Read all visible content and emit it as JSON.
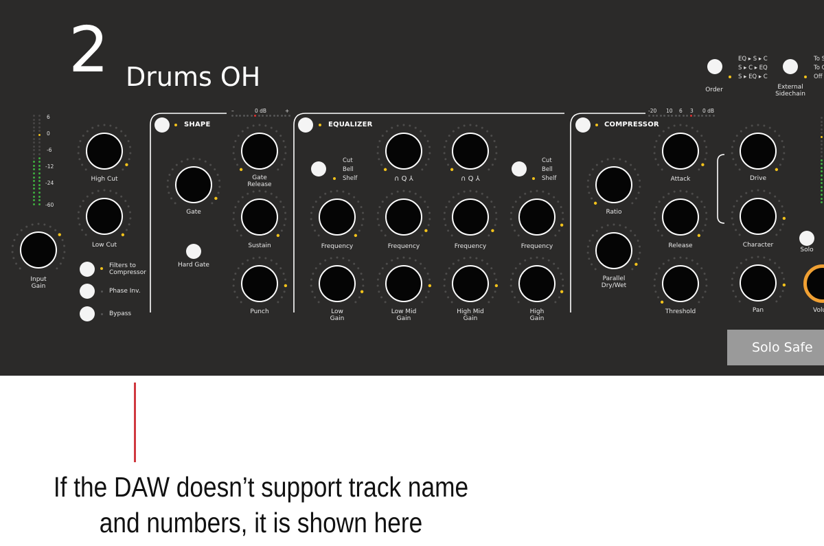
{
  "track": {
    "number": "2",
    "name": "Drums OH"
  },
  "order": {
    "label": "Order",
    "options": [
      "EQ ▸ S ▸ C",
      "S ▸ C ▸ EQ",
      "S ▸ EQ ▸ C"
    ]
  },
  "sidechain": {
    "label": "External\nSidechain",
    "options": [
      "To S",
      "To C",
      "Off"
    ]
  },
  "input": {
    "meter_scale": [
      "6",
      "0",
      "-6",
      "-12",
      "-24",
      "-60"
    ],
    "gain_label": "Input\nGain"
  },
  "filters": {
    "high_cut": "High Cut",
    "low_cut": "Low Cut"
  },
  "toggles": {
    "filters_to_compressor": "Filters to\nCompressor",
    "phase_inv": "Phase Inv.",
    "bypass": "Bypass"
  },
  "shape": {
    "title": "SHAPE",
    "gate": "Gate",
    "hard_gate": "Hard Gate",
    "gate_release": "Gate\nRelease",
    "sustain": "Sustain",
    "punch": "Punch",
    "scale": [
      "–",
      "0 dB",
      "+"
    ]
  },
  "equalizer": {
    "title": "EQUALIZER",
    "low_shape": [
      "Cut",
      "Bell",
      "Shelf"
    ],
    "high_shape": [
      "Cut",
      "Bell",
      "Shelf"
    ],
    "q_label": "∩  Q  ⅄",
    "freq_label": "Frequency",
    "gains": [
      "Low\nGain",
      "Low Mid\nGain",
      "High Mid\nGain",
      "High\nGain"
    ]
  },
  "compressor": {
    "title": "COMPRESSOR",
    "ratio": "Ratio",
    "parallel": "Parallel\nDry/Wet",
    "attack": "Attack",
    "release": "Release",
    "threshold": "Threshold",
    "scale": [
      "-20",
      "10",
      "6",
      "3",
      "0 dB"
    ]
  },
  "output": {
    "drive": "Drive",
    "character": "Character",
    "pan": "Pan",
    "solo": "Solo",
    "volume": "Volu",
    "solo_safe": "Solo Safe"
  },
  "annotation": "If the DAW doesn’t support track name\nand numbers, it is shown here",
  "colors": {
    "panel": "#2b2a29",
    "accent_yellow": "#f2c21b",
    "meter_green": "#3fae3f",
    "meter_red": "#e03030",
    "volume_orange": "#f0a033",
    "callout_red": "#d0383f"
  }
}
